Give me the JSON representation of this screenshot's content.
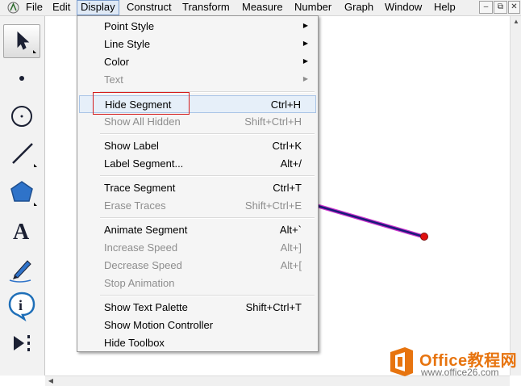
{
  "menubar": {
    "items": [
      "File",
      "Edit",
      "Display",
      "Construct",
      "Transform",
      "Measure",
      "Number",
      "Graph",
      "Window",
      "Help"
    ],
    "open_item": "Display",
    "window_buttons": [
      "–",
      "⧉",
      "✕"
    ]
  },
  "toolbox": {
    "tools": [
      {
        "name": "arrow-select-tool",
        "selected": true
      },
      {
        "name": "point-tool"
      },
      {
        "name": "compass-tool"
      },
      {
        "name": "straightedge-tool"
      },
      {
        "name": "polygon-tool"
      },
      {
        "name": "text-tool",
        "glyph": "A"
      },
      {
        "name": "marker-tool"
      },
      {
        "name": "information-tool",
        "glyph": "i"
      },
      {
        "name": "custom-tool"
      }
    ]
  },
  "display_menu": {
    "items": [
      {
        "label": "Point Style",
        "submenu": true
      },
      {
        "label": "Line Style",
        "submenu": true
      },
      {
        "label": "Color",
        "submenu": true
      },
      {
        "label": "Text",
        "submenu": true,
        "disabled": true
      },
      {
        "label": "Hide Segment",
        "shortcut": "Ctrl+H",
        "highlighted": true
      },
      {
        "label": "Show All Hidden",
        "shortcut": "Shift+Ctrl+H",
        "disabled": true
      },
      {
        "label": "Show Label",
        "shortcut": "Ctrl+K"
      },
      {
        "label": "Label Segment...",
        "shortcut": "Alt+/"
      },
      {
        "label": "Trace Segment",
        "shortcut": "Ctrl+T"
      },
      {
        "label": "Erase Traces",
        "shortcut": "Shift+Ctrl+E",
        "disabled": true
      },
      {
        "label": "Animate Segment",
        "shortcut": "Alt+`"
      },
      {
        "label": "Increase Speed",
        "shortcut": "Alt+]",
        "disabled": true
      },
      {
        "label": "Decrease Speed",
        "shortcut": "Alt+[",
        "disabled": true
      },
      {
        "label": "Stop Animation",
        "disabled": true
      },
      {
        "label": "Show Text Palette",
        "shortcut": "Shift+Ctrl+T"
      },
      {
        "label": "Show Motion Controller"
      },
      {
        "label": "Hide Toolbox"
      }
    ]
  },
  "canvas": {
    "segment_color": "#1a1a7a",
    "segment_highlight_color": "#cc33cc",
    "endpoint_color": "#e01010"
  },
  "watermark": {
    "title": "Office教程网",
    "url": "www.office26.com",
    "brand_color": "#e7740f"
  }
}
